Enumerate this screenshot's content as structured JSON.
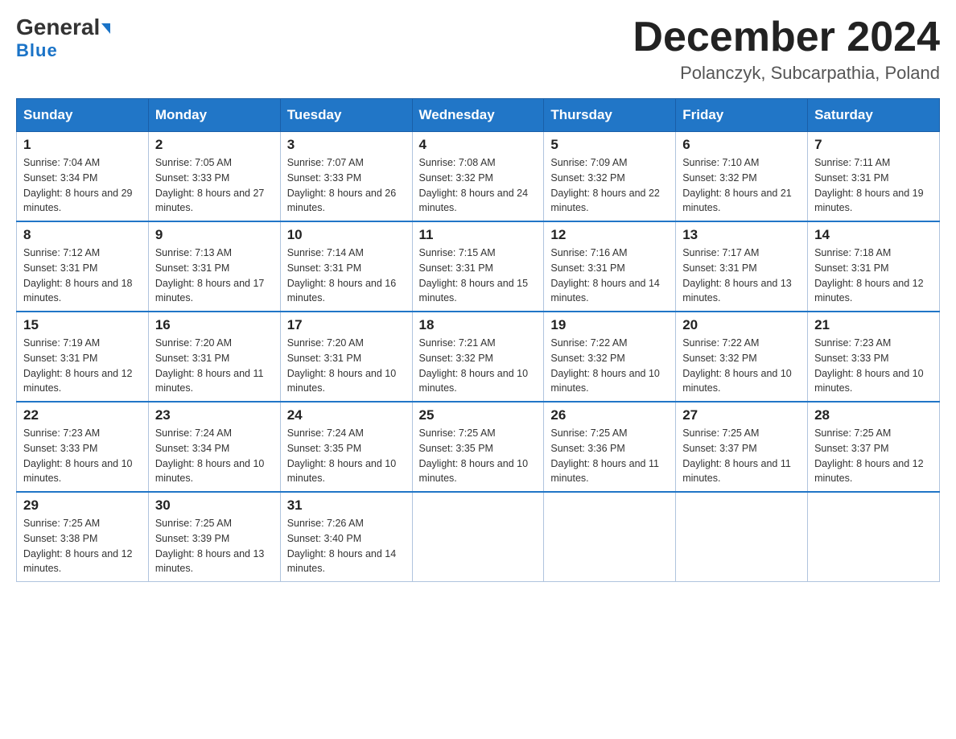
{
  "header": {
    "logo_text1": "General",
    "logo_text2": "Blue",
    "month_title": "December 2024",
    "location": "Polanczyk, Subcarpathia, Poland"
  },
  "weekdays": [
    "Sunday",
    "Monday",
    "Tuesday",
    "Wednesday",
    "Thursday",
    "Friday",
    "Saturday"
  ],
  "weeks": [
    [
      {
        "day": "1",
        "sunrise": "Sunrise: 7:04 AM",
        "sunset": "Sunset: 3:34 PM",
        "daylight": "Daylight: 8 hours and 29 minutes."
      },
      {
        "day": "2",
        "sunrise": "Sunrise: 7:05 AM",
        "sunset": "Sunset: 3:33 PM",
        "daylight": "Daylight: 8 hours and 27 minutes."
      },
      {
        "day": "3",
        "sunrise": "Sunrise: 7:07 AM",
        "sunset": "Sunset: 3:33 PM",
        "daylight": "Daylight: 8 hours and 26 minutes."
      },
      {
        "day": "4",
        "sunrise": "Sunrise: 7:08 AM",
        "sunset": "Sunset: 3:32 PM",
        "daylight": "Daylight: 8 hours and 24 minutes."
      },
      {
        "day": "5",
        "sunrise": "Sunrise: 7:09 AM",
        "sunset": "Sunset: 3:32 PM",
        "daylight": "Daylight: 8 hours and 22 minutes."
      },
      {
        "day": "6",
        "sunrise": "Sunrise: 7:10 AM",
        "sunset": "Sunset: 3:32 PM",
        "daylight": "Daylight: 8 hours and 21 minutes."
      },
      {
        "day": "7",
        "sunrise": "Sunrise: 7:11 AM",
        "sunset": "Sunset: 3:31 PM",
        "daylight": "Daylight: 8 hours and 19 minutes."
      }
    ],
    [
      {
        "day": "8",
        "sunrise": "Sunrise: 7:12 AM",
        "sunset": "Sunset: 3:31 PM",
        "daylight": "Daylight: 8 hours and 18 minutes."
      },
      {
        "day": "9",
        "sunrise": "Sunrise: 7:13 AM",
        "sunset": "Sunset: 3:31 PM",
        "daylight": "Daylight: 8 hours and 17 minutes."
      },
      {
        "day": "10",
        "sunrise": "Sunrise: 7:14 AM",
        "sunset": "Sunset: 3:31 PM",
        "daylight": "Daylight: 8 hours and 16 minutes."
      },
      {
        "day": "11",
        "sunrise": "Sunrise: 7:15 AM",
        "sunset": "Sunset: 3:31 PM",
        "daylight": "Daylight: 8 hours and 15 minutes."
      },
      {
        "day": "12",
        "sunrise": "Sunrise: 7:16 AM",
        "sunset": "Sunset: 3:31 PM",
        "daylight": "Daylight: 8 hours and 14 minutes."
      },
      {
        "day": "13",
        "sunrise": "Sunrise: 7:17 AM",
        "sunset": "Sunset: 3:31 PM",
        "daylight": "Daylight: 8 hours and 13 minutes."
      },
      {
        "day": "14",
        "sunrise": "Sunrise: 7:18 AM",
        "sunset": "Sunset: 3:31 PM",
        "daylight": "Daylight: 8 hours and 12 minutes."
      }
    ],
    [
      {
        "day": "15",
        "sunrise": "Sunrise: 7:19 AM",
        "sunset": "Sunset: 3:31 PM",
        "daylight": "Daylight: 8 hours and 12 minutes."
      },
      {
        "day": "16",
        "sunrise": "Sunrise: 7:20 AM",
        "sunset": "Sunset: 3:31 PM",
        "daylight": "Daylight: 8 hours and 11 minutes."
      },
      {
        "day": "17",
        "sunrise": "Sunrise: 7:20 AM",
        "sunset": "Sunset: 3:31 PM",
        "daylight": "Daylight: 8 hours and 10 minutes."
      },
      {
        "day": "18",
        "sunrise": "Sunrise: 7:21 AM",
        "sunset": "Sunset: 3:32 PM",
        "daylight": "Daylight: 8 hours and 10 minutes."
      },
      {
        "day": "19",
        "sunrise": "Sunrise: 7:22 AM",
        "sunset": "Sunset: 3:32 PM",
        "daylight": "Daylight: 8 hours and 10 minutes."
      },
      {
        "day": "20",
        "sunrise": "Sunrise: 7:22 AM",
        "sunset": "Sunset: 3:32 PM",
        "daylight": "Daylight: 8 hours and 10 minutes."
      },
      {
        "day": "21",
        "sunrise": "Sunrise: 7:23 AM",
        "sunset": "Sunset: 3:33 PM",
        "daylight": "Daylight: 8 hours and 10 minutes."
      }
    ],
    [
      {
        "day": "22",
        "sunrise": "Sunrise: 7:23 AM",
        "sunset": "Sunset: 3:33 PM",
        "daylight": "Daylight: 8 hours and 10 minutes."
      },
      {
        "day": "23",
        "sunrise": "Sunrise: 7:24 AM",
        "sunset": "Sunset: 3:34 PM",
        "daylight": "Daylight: 8 hours and 10 minutes."
      },
      {
        "day": "24",
        "sunrise": "Sunrise: 7:24 AM",
        "sunset": "Sunset: 3:35 PM",
        "daylight": "Daylight: 8 hours and 10 minutes."
      },
      {
        "day": "25",
        "sunrise": "Sunrise: 7:25 AM",
        "sunset": "Sunset: 3:35 PM",
        "daylight": "Daylight: 8 hours and 10 minutes."
      },
      {
        "day": "26",
        "sunrise": "Sunrise: 7:25 AM",
        "sunset": "Sunset: 3:36 PM",
        "daylight": "Daylight: 8 hours and 11 minutes."
      },
      {
        "day": "27",
        "sunrise": "Sunrise: 7:25 AM",
        "sunset": "Sunset: 3:37 PM",
        "daylight": "Daylight: 8 hours and 11 minutes."
      },
      {
        "day": "28",
        "sunrise": "Sunrise: 7:25 AM",
        "sunset": "Sunset: 3:37 PM",
        "daylight": "Daylight: 8 hours and 12 minutes."
      }
    ],
    [
      {
        "day": "29",
        "sunrise": "Sunrise: 7:25 AM",
        "sunset": "Sunset: 3:38 PM",
        "daylight": "Daylight: 8 hours and 12 minutes."
      },
      {
        "day": "30",
        "sunrise": "Sunrise: 7:25 AM",
        "sunset": "Sunset: 3:39 PM",
        "daylight": "Daylight: 8 hours and 13 minutes."
      },
      {
        "day": "31",
        "sunrise": "Sunrise: 7:26 AM",
        "sunset": "Sunset: 3:40 PM",
        "daylight": "Daylight: 8 hours and 14 minutes."
      },
      null,
      null,
      null,
      null
    ]
  ]
}
